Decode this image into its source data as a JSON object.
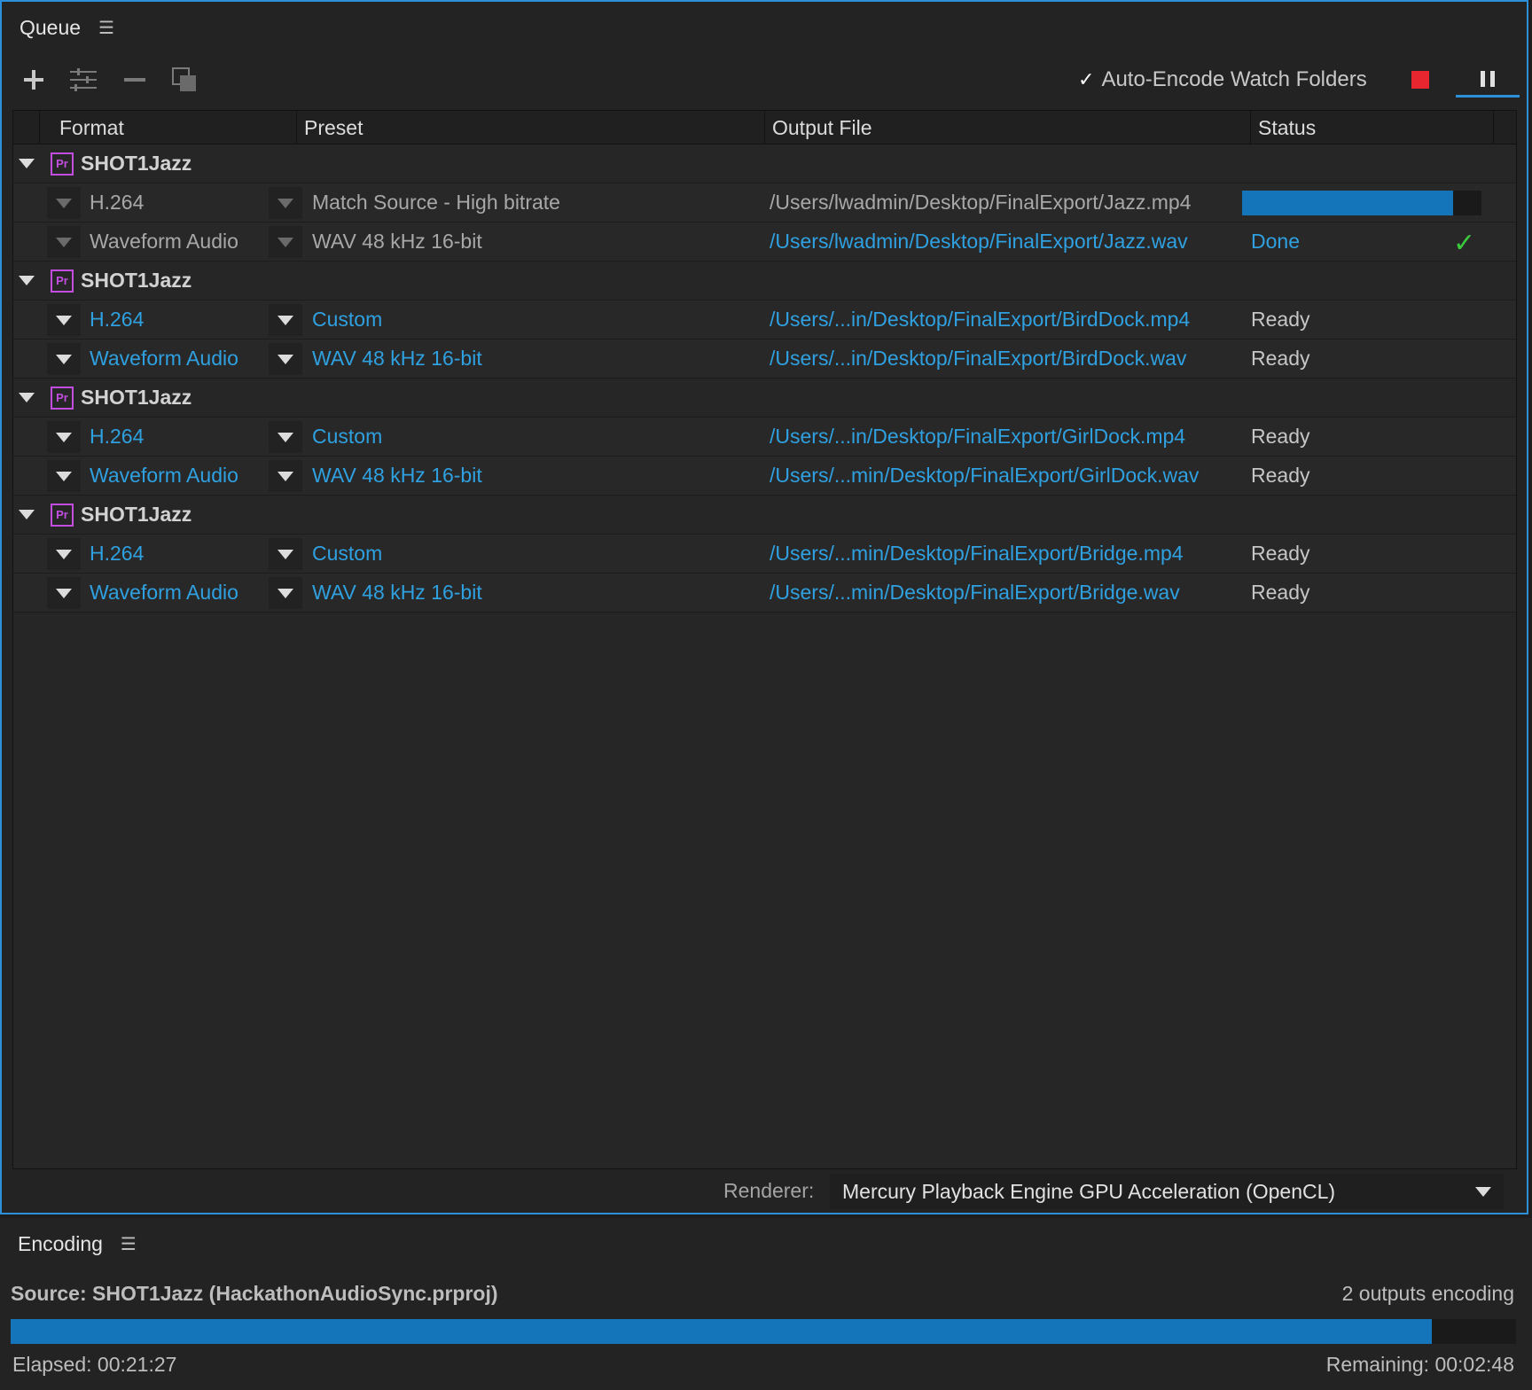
{
  "queue_panel": {
    "title": "Queue",
    "menu_icon": "hamburger-menu-icon",
    "toolbar": {
      "add_icon": "plus-icon",
      "settings_icon": "preset-settings-icon",
      "remove_icon": "minus-icon",
      "duplicate_icon": "duplicate-icon"
    },
    "auto_encode": {
      "checked": true,
      "label": "Auto-Encode Watch Folders"
    },
    "stop_color": "#e8262f",
    "accent_color": "#2d8fd8"
  },
  "table": {
    "columns": [
      "Format",
      "Preset",
      "Output File",
      "Status"
    ],
    "groups": [
      {
        "name": "SHOT1Jazz",
        "items": [
          {
            "format": "H.264",
            "preset": "Match Source - High bitrate",
            "output": "/Users/lwadmin/Desktop/FinalExport/Jazz.mp4",
            "status": "",
            "progress": 0.88,
            "style": "dim"
          },
          {
            "format": "Waveform Audio",
            "preset": "WAV 48 kHz 16-bit",
            "output": "/Users/lwadmin/Desktop/FinalExport/Jazz.wav",
            "status": "Done",
            "done": true,
            "style": "dim"
          }
        ]
      },
      {
        "name": "SHOT1Jazz",
        "items": [
          {
            "format": "H.264",
            "preset": "Custom",
            "output": "/Users/...in/Desktop/FinalExport/BirdDock.mp4",
            "status": "Ready",
            "style": "blue"
          },
          {
            "format": "Waveform Audio",
            "preset": "WAV 48 kHz 16-bit",
            "output": "/Users/...in/Desktop/FinalExport/BirdDock.wav",
            "status": "Ready",
            "style": "blue"
          }
        ]
      },
      {
        "name": "SHOT1Jazz",
        "items": [
          {
            "format": "H.264",
            "preset": "Custom",
            "output": "/Users/...in/Desktop/FinalExport/GirlDock.mp4",
            "status": "Ready",
            "style": "blue"
          },
          {
            "format": "Waveform Audio",
            "preset": "WAV 48 kHz 16-bit",
            "output": "/Users/...min/Desktop/FinalExport/GirlDock.wav",
            "status": "Ready",
            "style": "blue"
          }
        ]
      },
      {
        "name": "SHOT1Jazz",
        "items": [
          {
            "format": "H.264",
            "preset": "Custom",
            "output": "/Users/...min/Desktop/FinalExport/Bridge.mp4",
            "status": "Ready",
            "style": "blue"
          },
          {
            "format": "Waveform Audio",
            "preset": "WAV 48 kHz 16-bit",
            "output": "/Users/...min/Desktop/FinalExport/Bridge.wav",
            "status": "Ready",
            "style": "blue"
          }
        ]
      }
    ],
    "group_icon_text": "Pr"
  },
  "renderer": {
    "label": "Renderer:",
    "value": "Mercury Playback Engine GPU Acceleration (OpenCL)"
  },
  "encoding_panel": {
    "title": "Encoding",
    "source": "Source: SHOT1Jazz (HackathonAudioSync.prproj)",
    "outputs": "2 outputs encoding",
    "progress": 0.944,
    "elapsed": "Elapsed: 00:21:27",
    "remaining": "Remaining: 00:02:48"
  }
}
